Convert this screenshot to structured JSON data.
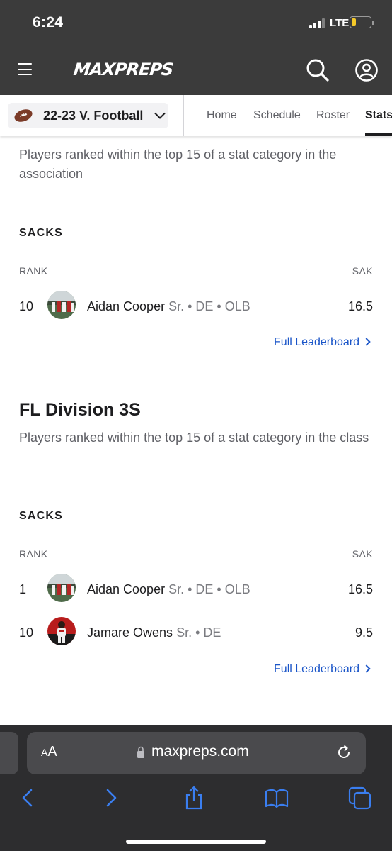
{
  "status_bar": {
    "time": "6:24",
    "network": "LTE",
    "battery_level": 0.25
  },
  "header": {
    "logo_text": "MAXPREPS"
  },
  "subnav": {
    "team_selector": "22-23 V. Football",
    "tabs": [
      {
        "label": "Home"
      },
      {
        "label": "Schedule"
      },
      {
        "label": "Roster"
      },
      {
        "label": "Stats",
        "active": true
      }
    ]
  },
  "section1": {
    "description": "Players ranked within the top 15 of a stat category in the association",
    "category": "SACKS",
    "rank_header": "RANK",
    "stat_header": "SAK",
    "rows": [
      {
        "rank": "10",
        "name": "Aidan Cooper",
        "meta": "Sr. • DE • OLB",
        "value": "16.5"
      }
    ],
    "link": "Full Leaderboard"
  },
  "section2": {
    "title": "FL Division 3S",
    "description": "Players ranked within the top 15 of a stat category in the class",
    "category": "SACKS",
    "rank_header": "RANK",
    "stat_header": "SAK",
    "rows": [
      {
        "rank": "1",
        "name": "Aidan Cooper",
        "meta": "Sr. • DE • OLB",
        "value": "16.5"
      },
      {
        "rank": "10",
        "name": "Jamare Owens",
        "meta": "Sr. • DE",
        "value": "9.5"
      }
    ],
    "link": "Full Leaderboard"
  },
  "browser": {
    "text_size_label_big": "A",
    "text_size_label_small": "A",
    "url": "maxpreps.com"
  },
  "colors": {
    "link": "#1a55c8",
    "header_bg": "#3b3b3b",
    "browser_bg": "#2d2d2f",
    "toolbar_icon": "#3a7ef0"
  }
}
